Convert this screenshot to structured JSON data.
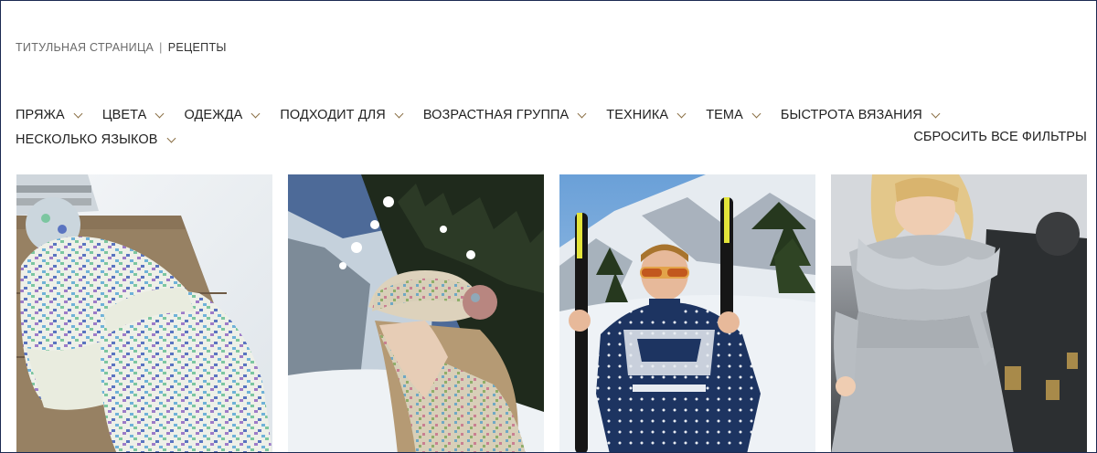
{
  "breadcrumb": {
    "home": "ТИТУЛЬНАЯ СТРАНИЦА",
    "separator": "|",
    "current": "РЕЦЕПТЫ"
  },
  "filters": [
    {
      "label": "ПРЯЖА"
    },
    {
      "label": "ЦВЕТА"
    },
    {
      "label": "ОДЕЖДА"
    },
    {
      "label": "ПОДХОДИТ ДЛЯ"
    },
    {
      "label": "ВОЗРАСТНАЯ ГРУППА"
    },
    {
      "label": "ТЕХНИКА"
    },
    {
      "label": "ТЕМА"
    },
    {
      "label": "БЫСТРОТА ВЯЗАНИЯ"
    },
    {
      "label": "НЕСКОЛЬКО ЯЗЫКОВ"
    }
  ],
  "reset_filters": "СБРОСИТЬ ВСЕ ФИЛЬТРЫ",
  "colors": {
    "border": "#1c2a52",
    "chevron": "#8a6f44"
  },
  "products": [
    {
      "image": "knitted-hat-and-mittens-on-snowy-bench"
    },
    {
      "image": "girl-in-knitted-beanie-in-snowy-forest"
    },
    {
      "image": "man-in-nordic-sweater-holding-skis"
    },
    {
      "image": "girl-in-grey-ruffle-knit-dress"
    }
  ]
}
